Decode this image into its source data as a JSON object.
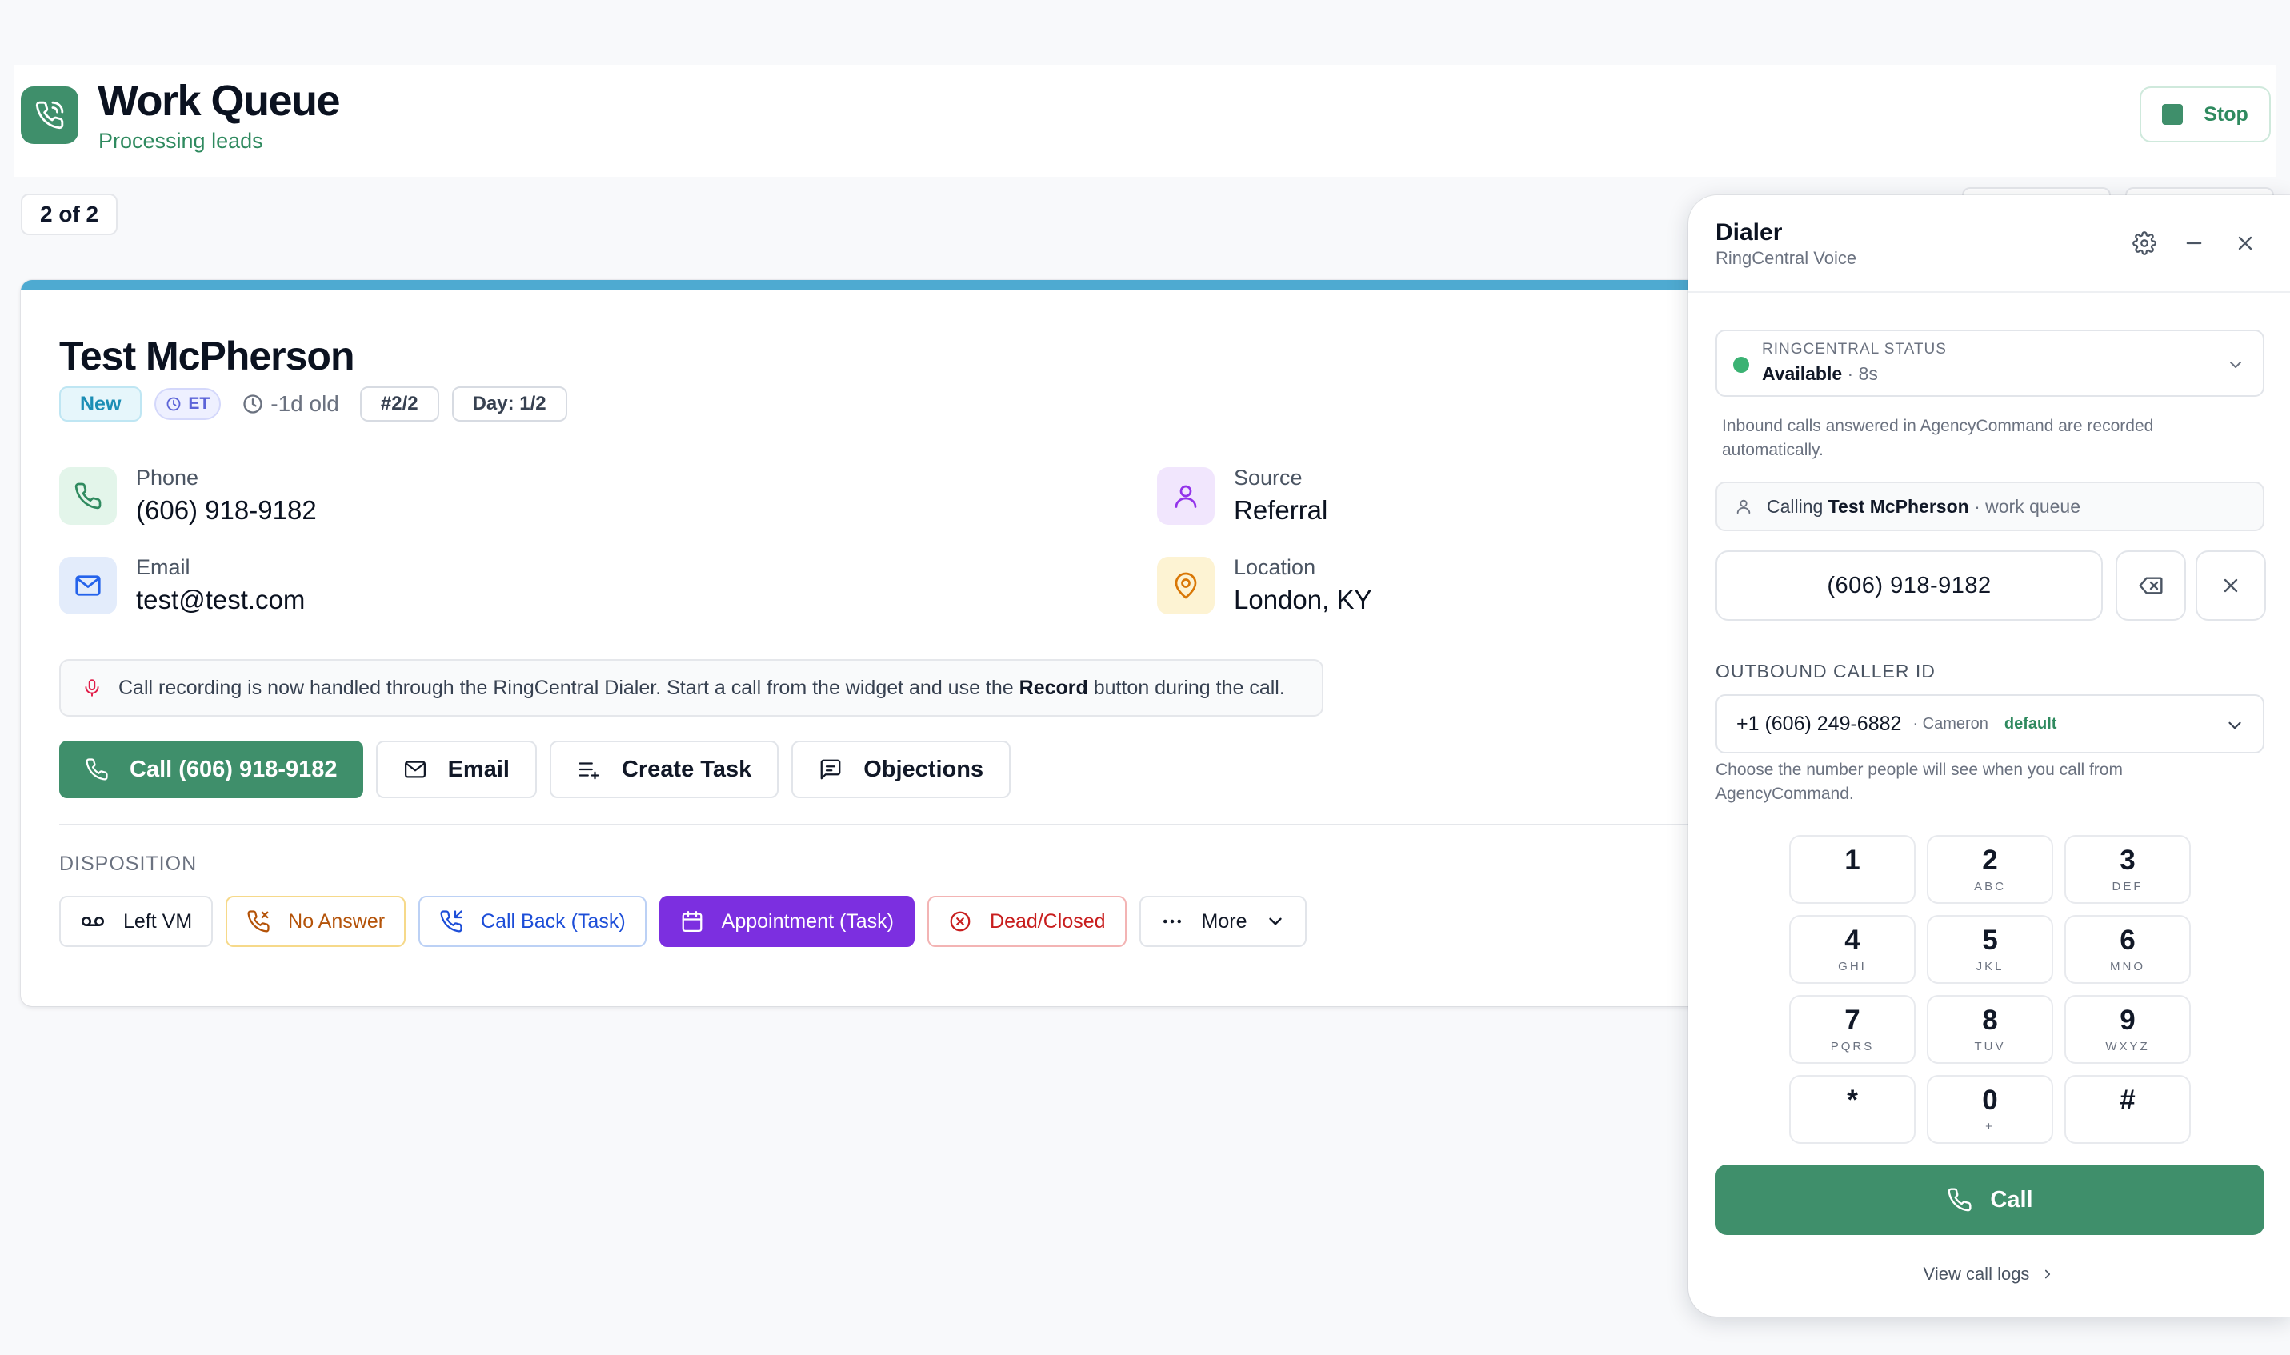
{
  "header": {
    "title": "Work Queue",
    "subtitle": "Processing leads",
    "stop_label": "Stop"
  },
  "queue": {
    "counter": "2 of 2"
  },
  "lead": {
    "name": "Test McPherson",
    "chips": {
      "status": "New",
      "timezone": "ET",
      "age": "-1d old",
      "position": "#2/2",
      "day": "Day: 1/2"
    },
    "fields": {
      "phone": {
        "label": "Phone",
        "value": "(606) 918-9182"
      },
      "email": {
        "label": "Email",
        "value": "test@test.com"
      },
      "source": {
        "label": "Source",
        "value": "Referral"
      },
      "location": {
        "label": "Location",
        "value": "London, KY"
      }
    },
    "notice": {
      "before": "Call recording is now handled through the RingCentral Dialer. Start a call from the widget and use the",
      "bold": "Record",
      "after": "button during the call."
    },
    "actions": {
      "call": "Call (606) 918-9182",
      "email": "Email",
      "task": "Create Task",
      "objections": "Objections"
    },
    "disposition": {
      "title": "DISPOSITION",
      "left_vm": "Left VM",
      "no_answer": "No Answer",
      "call_back": "Call Back (Task)",
      "appointment": "Appointment (Task)",
      "dead": "Dead/Closed",
      "more": "More"
    }
  },
  "dialer": {
    "title": "Dialer",
    "subtitle": "RingCentral Voice",
    "status": {
      "label": "RINGCENTRAL STATUS",
      "value": "Available",
      "duration": "· 8s"
    },
    "inbound_note": "Inbound calls answered in AgencyCommand are recorded automatically.",
    "calling": {
      "prefix": "Calling",
      "name": "Test McPherson",
      "context": "· work queue"
    },
    "number": "(606) 918-9182",
    "outbound": {
      "label": "OUTBOUND CALLER ID",
      "number": "+1 (606) 249-6882",
      "owner": "· Cameron",
      "tag": "default",
      "help": "Choose the number people will see when you call from AgencyCommand."
    },
    "keypad": [
      {
        "digit": "1",
        "letters": ""
      },
      {
        "digit": "2",
        "letters": "ABC"
      },
      {
        "digit": "3",
        "letters": "DEF"
      },
      {
        "digit": "4",
        "letters": "GHI"
      },
      {
        "digit": "5",
        "letters": "JKL"
      },
      {
        "digit": "6",
        "letters": "MNO"
      },
      {
        "digit": "7",
        "letters": "PQRS"
      },
      {
        "digit": "8",
        "letters": "TUV"
      },
      {
        "digit": "9",
        "letters": "WXYZ"
      },
      {
        "digit": "*",
        "letters": ""
      },
      {
        "digit": "0",
        "letters": "+"
      },
      {
        "digit": "#",
        "letters": ""
      }
    ],
    "call_label": "Call",
    "logs_label": "View call logs"
  },
  "colors": {
    "brand_green": "#3f8f6b",
    "accent_blue": "#4eaad1",
    "appointment_purple": "#7c2fe0",
    "status_available": "#3bb273"
  }
}
